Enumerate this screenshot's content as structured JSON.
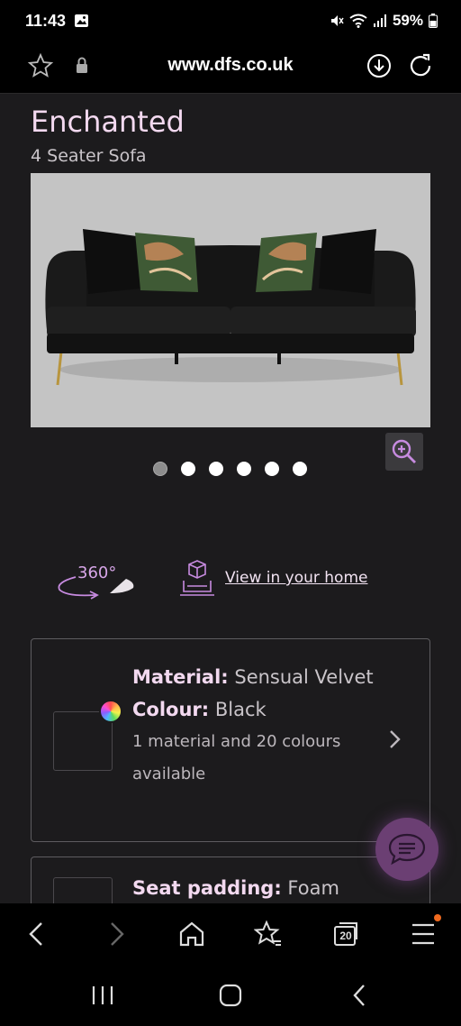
{
  "status_bar": {
    "time": "11:43",
    "battery": "59%"
  },
  "browser": {
    "url": "www.dfs.co.uk"
  },
  "product": {
    "title": "Enchanted",
    "subtitle": "4 Seater Sofa",
    "gallery_dot_count": 6,
    "active_dot": 0
  },
  "features": {
    "three60_label": "360°",
    "view_in_home_label": "View in your home"
  },
  "material_card": {
    "material_label": "Material:",
    "material_value": "Sensual Velvet",
    "colour_label": "Colour:",
    "colour_value": "Black",
    "availability": "1 material and 20 colours available"
  },
  "padding_card": {
    "label": "Seat padding:",
    "value": "Foam"
  },
  "browser_nav": {
    "tabs_count": "20"
  },
  "colors": {
    "accent": "#f3d9f0",
    "purple": "#d7a6e8",
    "background": "#1c1b1d",
    "notification": "#f06a1f"
  }
}
